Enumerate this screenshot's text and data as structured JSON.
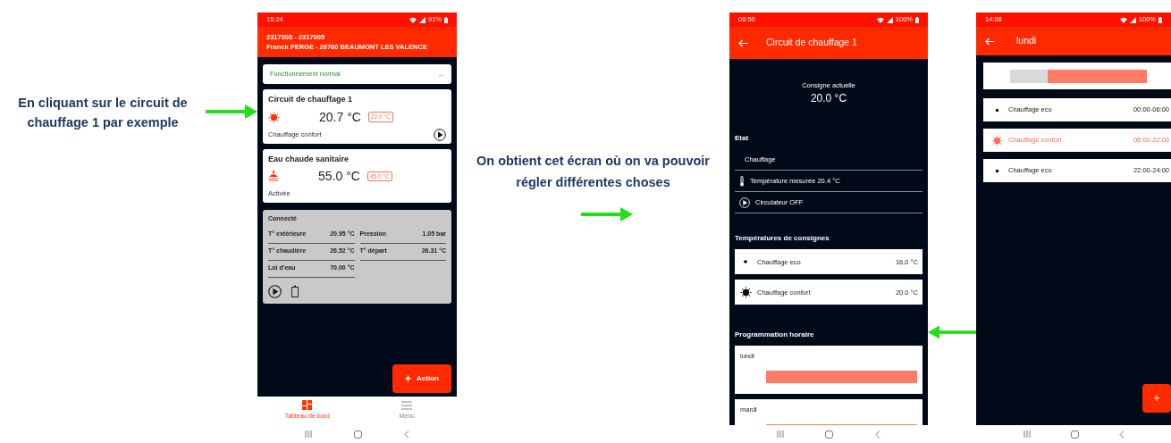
{
  "annotations": [
    {
      "text": "En cliquant sur le circuit de chauffage 1 par exemple"
    },
    {
      "text": "On obtient cet écran où on va pouvoir régler différentes choses"
    }
  ],
  "dashboard_screen": {
    "status_bar": {
      "time": "15:24",
      "battery": "91%"
    },
    "header": {
      "account": "2317005 - 2317005",
      "customer": "Franck PERGE - 26760 BEAUMONT LES VALENCE"
    },
    "status_card": {
      "text": "Fonctionnement normal",
      "menu": "..."
    },
    "circuits": [
      {
        "kind": "heating",
        "title": "Circuit de chauffage 1",
        "temperature": "20.7 °C",
        "setpoint": "22.0 °C",
        "mode": "Chauffage confort"
      },
      {
        "kind": "hot_water",
        "title": "Eau chaude sanitaire",
        "temperature": "55.0 °C",
        "setpoint": "45.0 °C",
        "mode": "Activée"
      }
    ],
    "boiler": {
      "status": "Connecté",
      "columns": [
        [
          {
            "label": "T° extérieure",
            "value": "20.95 °C"
          },
          {
            "label": "T° chaudière",
            "value": "26.52 °C"
          },
          {
            "label": "Loi d'eau",
            "value": "70.00 °C"
          }
        ],
        [
          {
            "label": "Pression",
            "value": "1.05 bar"
          },
          {
            "label": "T° départ",
            "value": "26.31 °C"
          }
        ]
      ]
    },
    "action_button": {
      "label": "Action",
      "icon": "+"
    },
    "nav": [
      {
        "kind": "dashboard",
        "label": "Tableau de bord",
        "selected": true
      },
      {
        "kind": "menu",
        "label": "Menu",
        "selected": false
      }
    ]
  },
  "circuit_screen": {
    "status_bar": {
      "time": "08:50",
      "battery": "100%"
    },
    "title": "Circuit de chauffage 1",
    "current_setpoint": {
      "label": "Consigne actuelle",
      "value": "20.0 °C"
    },
    "state": {
      "heading": "Etat",
      "items": [
        {
          "kind": "text",
          "text": "Chauffage"
        },
        {
          "kind": "thermometer",
          "text": "Température mesurée 20.4 °C"
        },
        {
          "kind": "pump",
          "text": "Circulateur OFF"
        }
      ]
    },
    "setpoints": {
      "heading": "Températures de consignes",
      "items": [
        {
          "kind": "eco",
          "label": "Chauffage eco",
          "value": "16.0 °C"
        },
        {
          "kind": "confort",
          "label": "Chauffage confort",
          "value": "20.0 °C"
        }
      ]
    },
    "schedule": {
      "heading": "Programmation horaire",
      "days": [
        {
          "day": "lundi"
        },
        {
          "day": "mardi"
        }
      ]
    }
  },
  "day_screen": {
    "status_bar": {
      "time": "14:08",
      "battery": "100%"
    },
    "title": "lundi",
    "periods": [
      {
        "kind": "eco",
        "label": "Chauffage eco",
        "time": "00:00-06:00"
      },
      {
        "kind": "confort",
        "label": "Chauffage confort",
        "time": "06:00-22:00"
      },
      {
        "kind": "eco",
        "label": "Chauffage eco",
        "time": "22:00-24:00"
      }
    ],
    "add_button": "+"
  }
}
